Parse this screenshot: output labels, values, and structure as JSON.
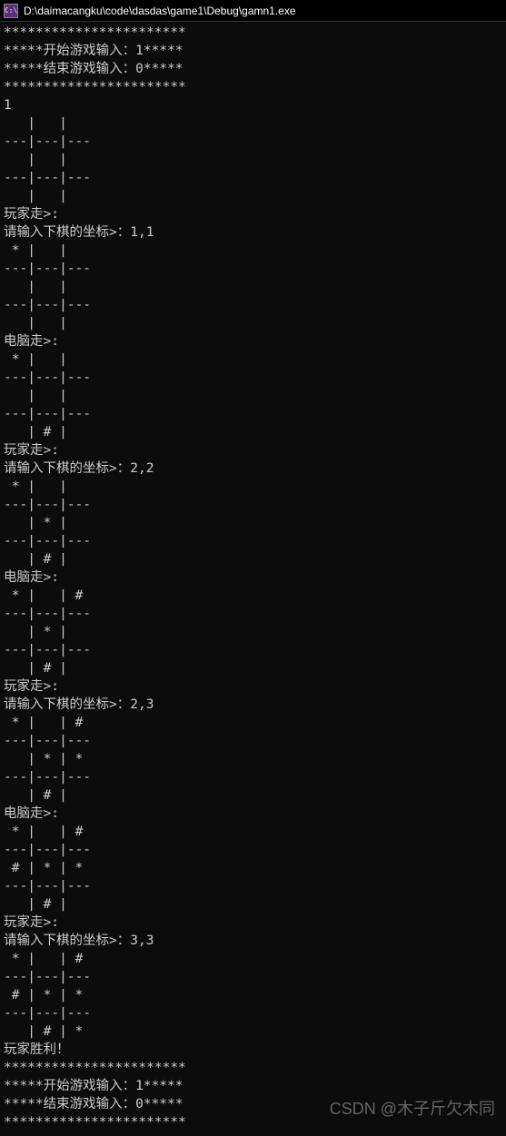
{
  "window": {
    "title": "D:\\daimacangku\\code\\dasdas\\game1\\Debug\\gamn1.exe",
    "icon_label": "C:\\"
  },
  "console_lines": [
    "***********************",
    "*****开始游戏输入：1*****",
    "*****结束游戏输入：0*****",
    "***********************",
    "1",
    "   |   |",
    "---|---|---",
    "   |   |",
    "---|---|---",
    "   |   |",
    "玩家走>:",
    "请输入下棋的坐标>：1,1",
    " * |   |",
    "---|---|---",
    "   |   |",
    "---|---|---",
    "   |   |",
    "电脑走>:",
    " * |   |",
    "---|---|---",
    "   |   |",
    "---|---|---",
    "   | # |",
    "玩家走>:",
    "请输入下棋的坐标>：2,2",
    " * |   |",
    "---|---|---",
    "   | * |",
    "---|---|---",
    "   | # |",
    "电脑走>:",
    " * |   | #",
    "---|---|---",
    "   | * |",
    "---|---|---",
    "   | # |",
    "玩家走>:",
    "请输入下棋的坐标>：2,3",
    " * |   | #",
    "---|---|---",
    "   | * | *",
    "---|---|---",
    "   | # |",
    "电脑走>:",
    " * |   | #",
    "---|---|---",
    " # | * | *",
    "---|---|---",
    "   | # |",
    "玩家走>:",
    "请输入下棋的坐标>：3,3",
    " * |   | #",
    "---|---|---",
    " # | * | *",
    "---|---|---",
    "   | # | *",
    "玩家胜利！",
    "***********************",
    "*****开始游戏输入：1*****",
    "*****结束游戏输入：0*****",
    "***********************"
  ],
  "watermark": "CSDN @木子斤欠木同"
}
